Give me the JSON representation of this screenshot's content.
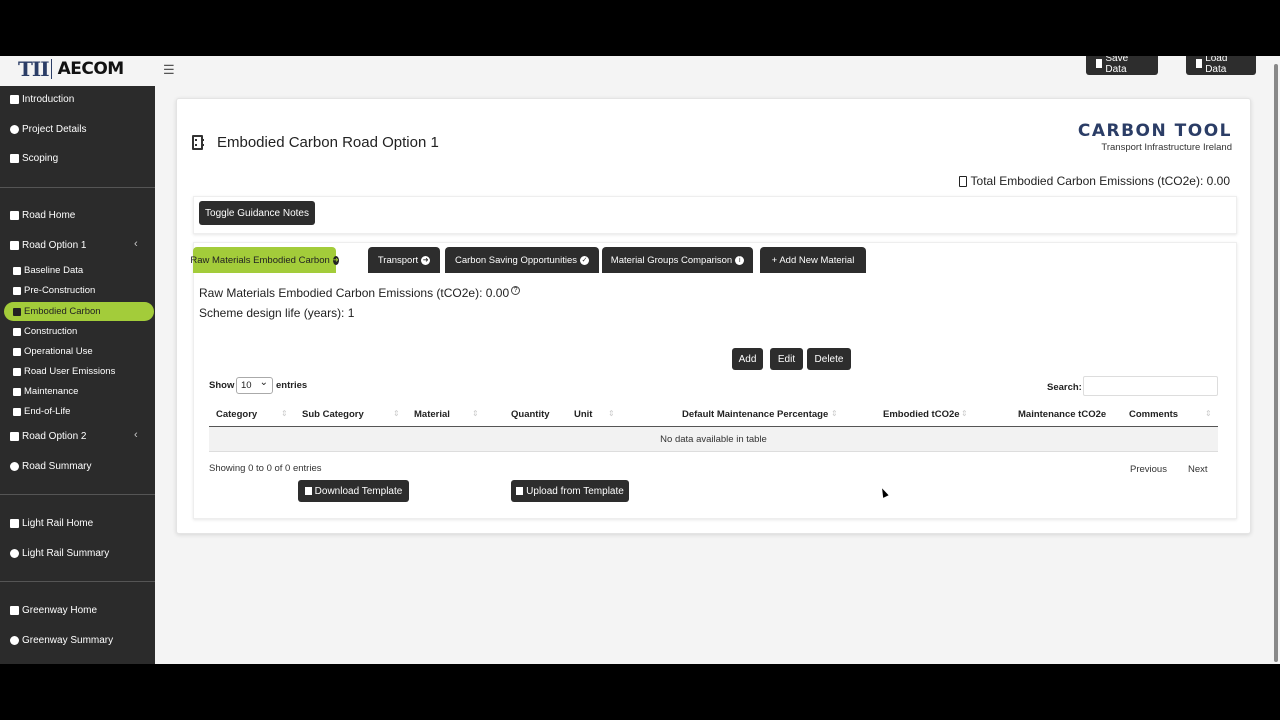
{
  "header": {
    "logo_tii": "TII",
    "logo_aecom": "AECOM",
    "save_label": "Save Data",
    "load_label": "Load Data"
  },
  "sidebar": {
    "items": [
      {
        "label": "Introduction",
        "icon": "book-icon"
      },
      {
        "label": "Project Details",
        "icon": "info-icon"
      },
      {
        "label": "Scoping",
        "icon": "scope-icon"
      },
      {
        "label": "Road Home",
        "icon": "road-icon"
      },
      {
        "label": "Road Option 1",
        "icon": "car-icon"
      },
      {
        "label": "Baseline Data",
        "icon": "pen-icon"
      },
      {
        "label": "Pre-Construction",
        "icon": "tools-icon"
      },
      {
        "label": "Embodied Carbon",
        "icon": "building-icon"
      },
      {
        "label": "Construction",
        "icon": "hardhat-icon"
      },
      {
        "label": "Operational Use",
        "icon": "car-icon"
      },
      {
        "label": "Road User Emissions",
        "icon": "users-icon"
      },
      {
        "label": "Maintenance",
        "icon": "wrench-icon"
      },
      {
        "label": "End-of-Life",
        "icon": "hourglass-icon"
      },
      {
        "label": "Road Option 2",
        "icon": "car-icon"
      },
      {
        "label": "Road Summary",
        "icon": "info-icon"
      },
      {
        "label": "Light Rail Home",
        "icon": "train-icon"
      },
      {
        "label": "Light Rail Summary",
        "icon": "info-icon"
      },
      {
        "label": "Greenway Home",
        "icon": "bicycle-icon"
      },
      {
        "label": "Greenway Summary",
        "icon": "info-icon"
      }
    ],
    "active_color": "#a3cc3a"
  },
  "main": {
    "title": "Embodied Carbon Road Option 1",
    "brand_title": "CARBON TOOL",
    "brand_sub": "Transport Infrastructure Ireland",
    "total_emissions": "Total Embodied Carbon Emissions (tCO2e): 0.00",
    "guidance_button": "Toggle Guidance Notes",
    "tabs": [
      {
        "label": "Raw Materials Embodied Carbon",
        "icon": "arrow-circle-icon"
      },
      {
        "label": "Transport",
        "icon": "arrow-circle-icon"
      },
      {
        "label": "Carbon Saving Opportunities",
        "icon": "check-circle-icon"
      },
      {
        "label": "Material Groups Comparison",
        "icon": "info-circle-icon"
      },
      {
        "label": "+ Add New Material",
        "icon": "plus-icon"
      }
    ],
    "raw_emissions": "Raw Materials Embodied Carbon Emissions (tCO2e): 0.00",
    "design_life": "Scheme design life (years): 1",
    "actions": {
      "add": "Add",
      "edit": "Edit",
      "delete": "Delete"
    },
    "table": {
      "show_label": "Show",
      "entries_value": "10",
      "entries_label": "entries",
      "search_label": "Search:",
      "search_value": "",
      "columns": [
        "Category",
        "Sub Category",
        "Material",
        "Quantity",
        "Unit",
        "Default Maintenance Percentage",
        "Embodied tCO2e",
        "Maintenance tCO2e",
        "Comments"
      ],
      "empty_message": "No data available in table",
      "info": "Showing 0 to 0 of 0 entries",
      "previous": "Previous",
      "next": "Next"
    },
    "download_template": "Download Template",
    "upload_template": "Upload from Template"
  }
}
